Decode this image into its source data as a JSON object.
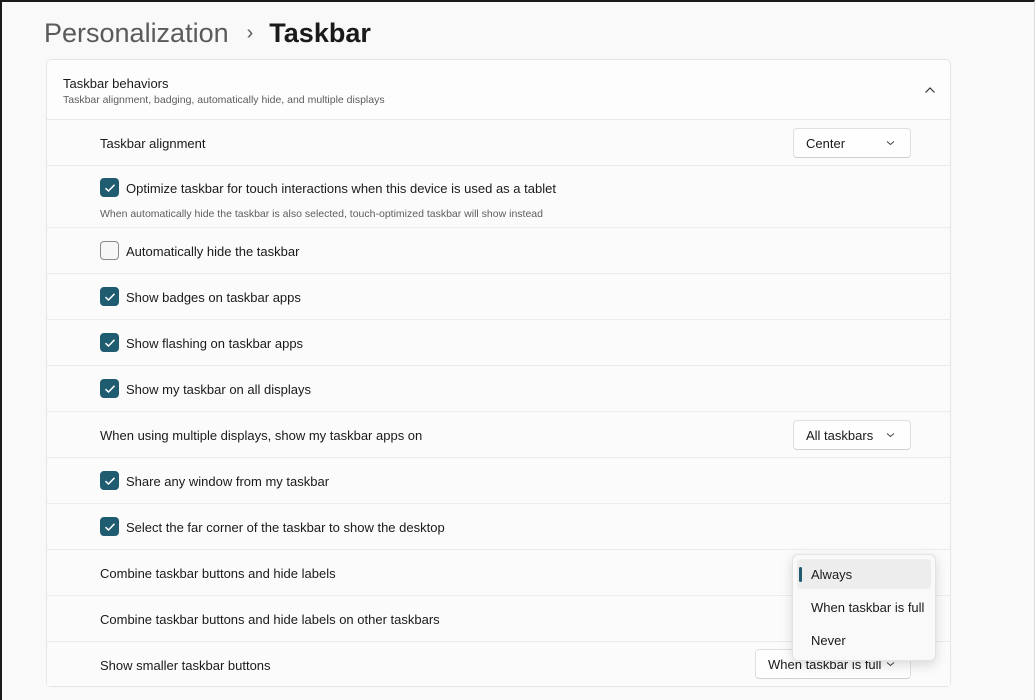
{
  "breadcrumb": {
    "parent": "Personalization",
    "separator": "›",
    "current": "Taskbar"
  },
  "section": {
    "title": "Taskbar behaviors",
    "subtitle": "Taskbar alignment, badging, automatically hide, and multiple displays",
    "expanded": true
  },
  "alignment": {
    "label": "Taskbar alignment",
    "value": "Center"
  },
  "touch": {
    "label": "Optimize taskbar for touch interactions when this device is used as a tablet",
    "description": "When automatically hide the taskbar is also selected, touch-optimized taskbar will show instead",
    "checked": true
  },
  "autohide": {
    "label": "Automatically hide the taskbar",
    "checked": false
  },
  "badges": {
    "label": "Show badges on taskbar apps",
    "checked": true
  },
  "flashing": {
    "label": "Show flashing on taskbar apps",
    "checked": true
  },
  "all_displays": {
    "label": "Show my taskbar on all displays",
    "checked": true
  },
  "multi_display": {
    "label": "When using multiple displays, show my taskbar apps on",
    "value": "All taskbars"
  },
  "share_window": {
    "label": "Share any window from my taskbar",
    "checked": true
  },
  "far_corner": {
    "label": "Select the far corner of the taskbar to show the desktop",
    "checked": true
  },
  "combine": {
    "label": "Combine taskbar buttons and hide labels"
  },
  "combine_other": {
    "label": "Combine taskbar buttons and hide labels on other taskbars"
  },
  "smaller_buttons": {
    "label": "Show smaller taskbar buttons",
    "value": "When taskbar is full"
  },
  "combine_menu": {
    "options": [
      "Always",
      "When taskbar is full",
      "Never"
    ],
    "selected": "Always"
  },
  "colors": {
    "accent": "#1f5c70",
    "text": "#1a1a1a",
    "secondary_text": "#5d5d5d"
  },
  "icons": {
    "chevron_up": "chevron-up-icon",
    "chevron_down": "chevron-down-icon",
    "checkmark": "checkmark-icon"
  }
}
